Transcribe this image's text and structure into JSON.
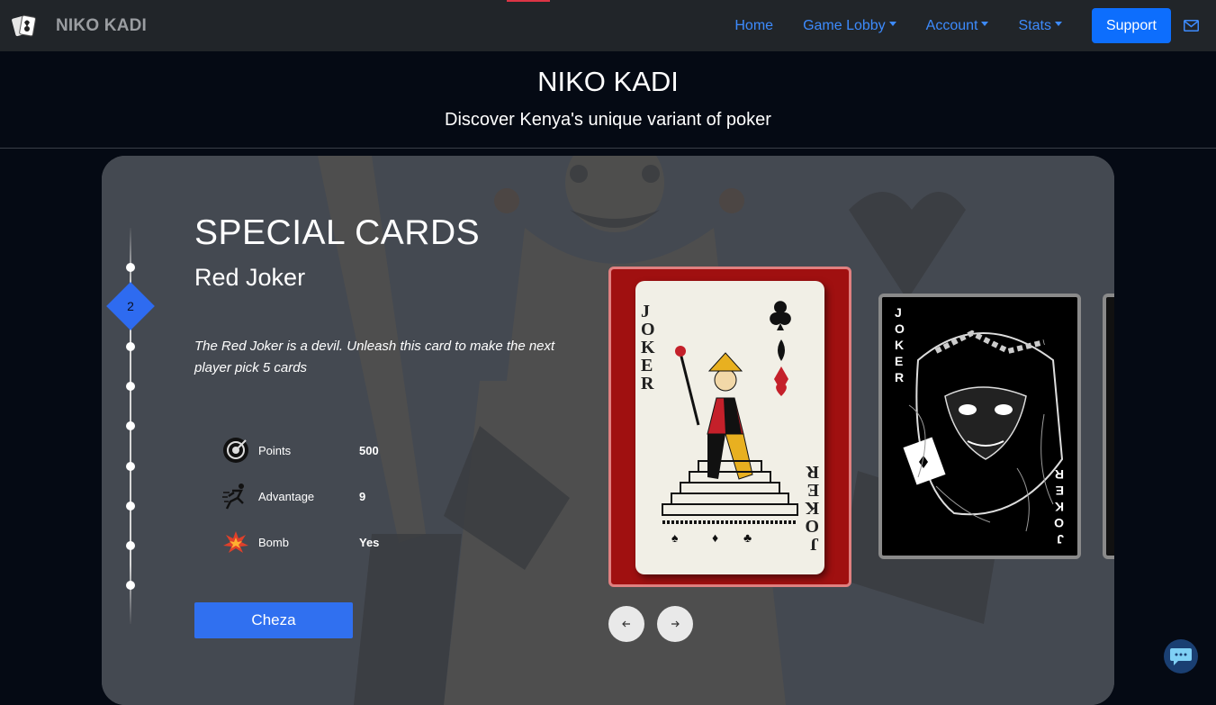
{
  "nav": {
    "brand": "NIKO KADI",
    "links": [
      {
        "label": "Home",
        "dropdown": false
      },
      {
        "label": "Game Lobby",
        "dropdown": true
      },
      {
        "label": "Account",
        "dropdown": true
      },
      {
        "label": "Stats",
        "dropdown": true
      }
    ],
    "support": "Support"
  },
  "header": {
    "title": "NIKO KADI",
    "subtitle": "Discover Kenya's unique variant of poker"
  },
  "section": {
    "title": "SPECIAL CARDS",
    "card_name": "Red Joker",
    "description": "The Red Joker is a devil. Unleash this card to make the next player pick 5 cards",
    "step": "2",
    "stats": [
      {
        "icon": "target-icon",
        "label": "Points",
        "value": "500"
      },
      {
        "icon": "runner-icon",
        "label": "Advantage",
        "value": "9"
      },
      {
        "icon": "explosion-icon",
        "label": "Bomb",
        "value": "Yes"
      }
    ],
    "cta": "Cheza"
  },
  "cards": {
    "active_text": "JOKER",
    "second_text": "JOKER"
  },
  "colors": {
    "accent_blue": "#0d6efd",
    "cta_blue": "#3070f0",
    "card_red": "#a01010"
  }
}
